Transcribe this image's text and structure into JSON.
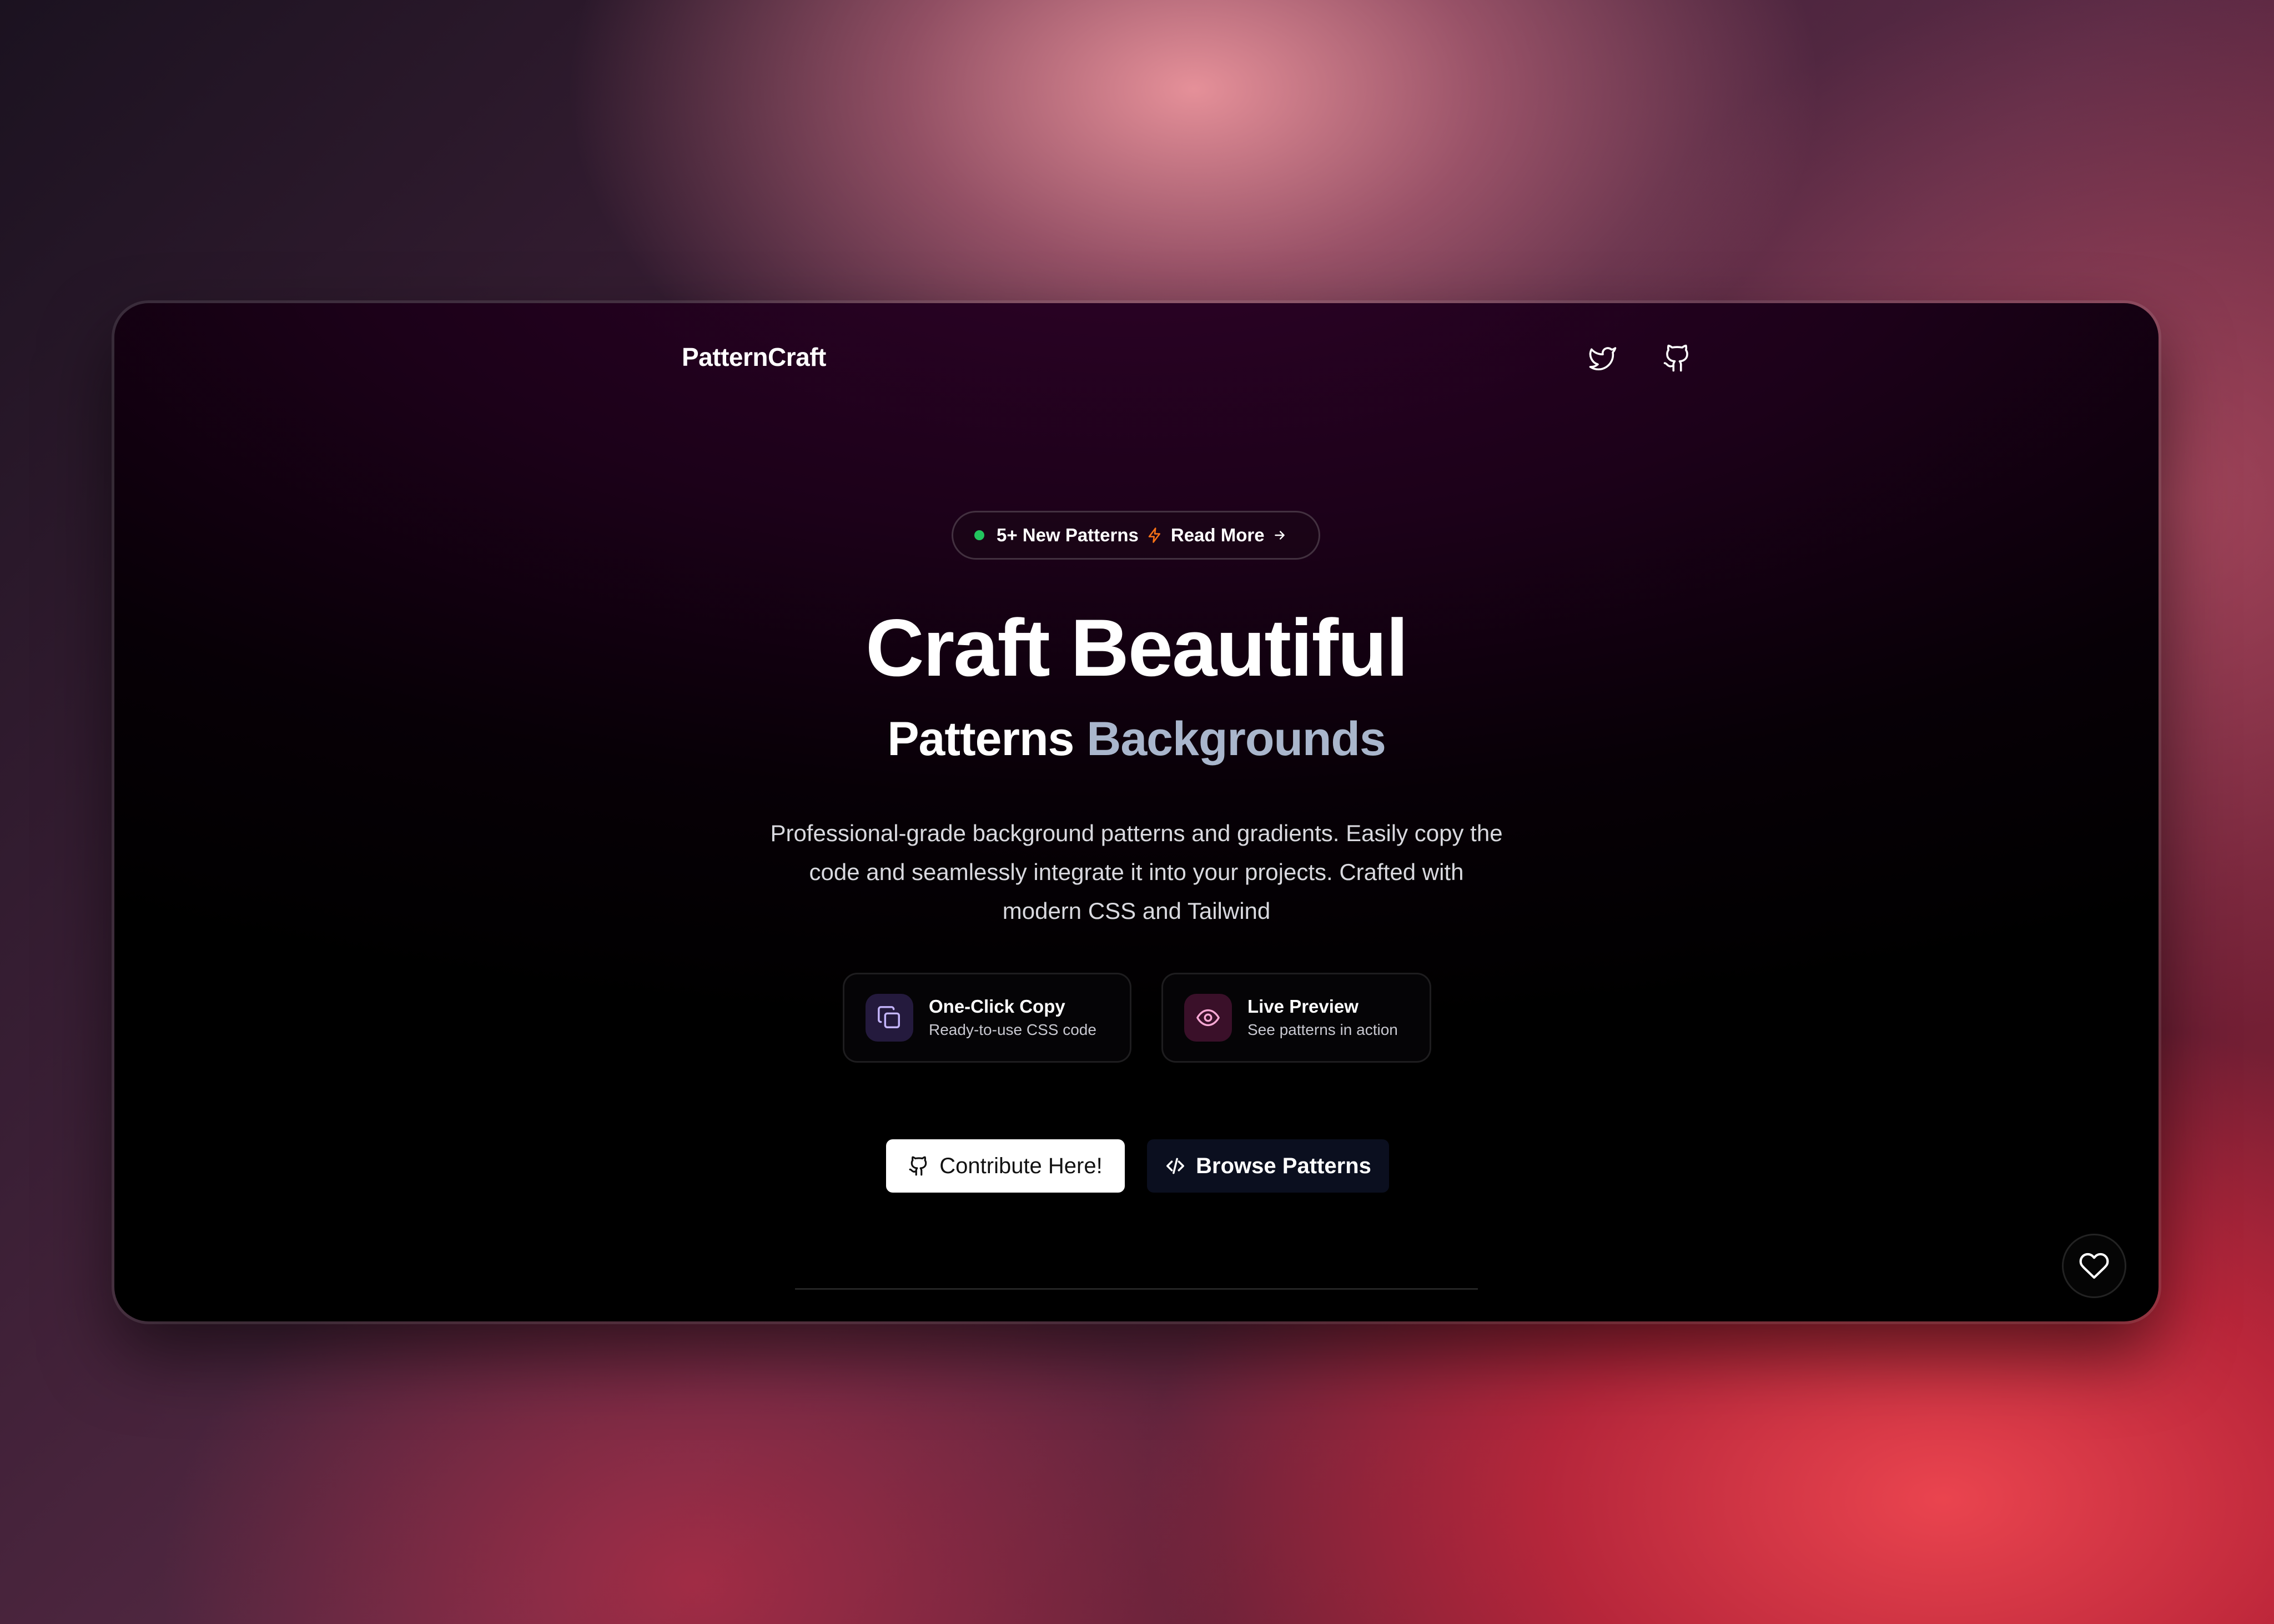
{
  "brand": "PatternCraft",
  "nav": {
    "twitter_icon": "twitter-icon",
    "github_icon": "github-icon"
  },
  "announcement": {
    "text": "5+ New Patterns",
    "link": "Read More",
    "dot_color": "#22c55e",
    "bolt_color": "#f97316"
  },
  "hero": {
    "title": "Craft Beautiful",
    "subtitle_part1": "Patterns",
    "subtitle_part2": "Backgrounds",
    "description": "Professional-grade background patterns and gradients. Easily copy the code and seamlessly integrate it into your projects. Crafted with modern CSS and Tailwind"
  },
  "features": [
    {
      "title": "One-Click Copy",
      "subtitle": "Ready-to-use CSS code",
      "icon": "copy-icon",
      "icon_bg": "#241a3d",
      "icon_color": "#c4b5fd"
    },
    {
      "title": "Live Preview",
      "subtitle": "See patterns in action",
      "icon": "eye-icon",
      "icon_bg": "#3a1029",
      "icon_color": "#f9a8d4"
    }
  ],
  "buttons": {
    "contribute": "Contribute Here!",
    "browse": "Browse Patterns"
  },
  "favorite_icon": "heart-icon"
}
